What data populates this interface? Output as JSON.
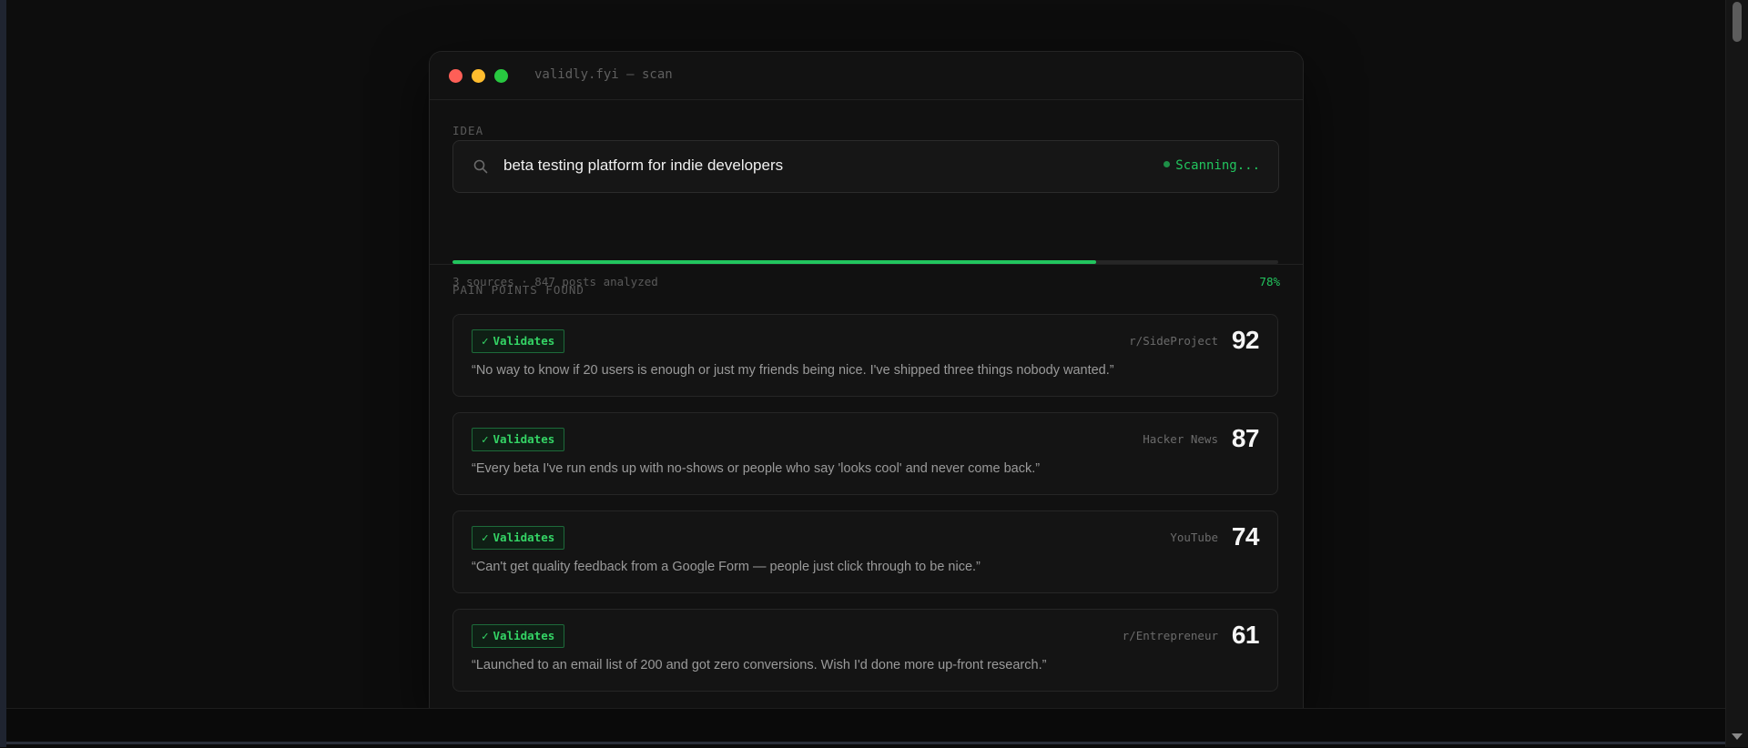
{
  "window": {
    "title": "validly.fyi — scan"
  },
  "idea": {
    "section_label": "IDEA",
    "query": "beta testing platform for indie developers",
    "status": "Scanning...",
    "progress_percent": 78,
    "progress_label": "78%",
    "meta": "3 sources · 847 posts analyzed"
  },
  "pain_points": {
    "section_label": "PAIN POINTS FOUND",
    "items": [
      {
        "badge": "Validates",
        "source": "r/SideProject",
        "score": "92",
        "quote": "“No way to know if 20 users is enough or just my friends being nice. I've shipped three things nobody wanted.”"
      },
      {
        "badge": "Validates",
        "source": "Hacker News",
        "score": "87",
        "quote": "“Every beta I've run ends up with no-shows or people who say 'looks cool' and never come back.”"
      },
      {
        "badge": "Validates",
        "source": "YouTube",
        "score": "74",
        "quote": "“Can't get quality feedback from a Google Form — people just click through to be nice.”"
      },
      {
        "badge": "Validates",
        "source": "r/Entrepreneur",
        "score": "61",
        "quote": "“Launched to an email list of 200 and got zero conversions. Wish I'd done more up-front research.”"
      }
    ]
  },
  "colors": {
    "accent": "#22c55e",
    "window_controls": [
      "#fe5f57",
      "#febc2e",
      "#28c840"
    ]
  },
  "icons": {
    "search": "search-icon",
    "check": "check-icon"
  }
}
